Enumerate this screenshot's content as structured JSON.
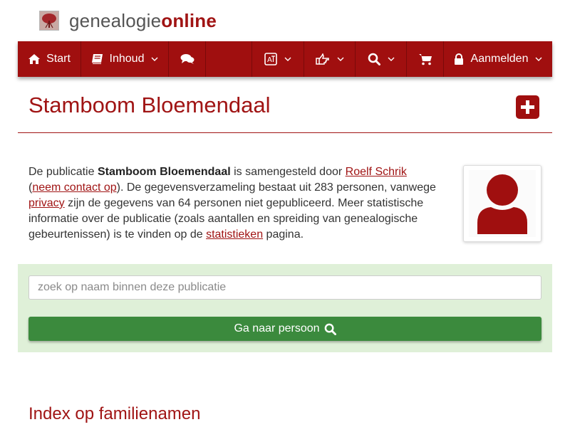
{
  "brand": {
    "part1": "genealogie",
    "part2": "online"
  },
  "nav": {
    "start": "Start",
    "inhoud": "Inhoud",
    "aanmelden": "Aanmelden"
  },
  "page": {
    "title": "Stamboom Bloemendaal"
  },
  "intro": {
    "t1": "De publicatie ",
    "pub_name": "Stamboom Bloemendaal",
    "t2": " is samengesteld door ",
    "author": "Roelf Schrik",
    "t3": "(",
    "contact": "neem contact op",
    "t4": "). De gegevensverzameling bestaat uit 283 personen, vanwege ",
    "privacy": "privacy",
    "t5": " zijn de gegevens van 64 personen niet gepubliceerd. Meer statistische informatie over de publicatie (zoals aantallen en spreiding van genealogische gebeurtenissen) is te vinden op de ",
    "stats": "statistieken",
    "t6": " pagina."
  },
  "search": {
    "placeholder": "zoek op naam binnen deze publicatie",
    "button": "Ga naar persoon"
  },
  "index": {
    "heading": "Index op familienamen"
  },
  "colors": {
    "brand_red": "#a00f0f",
    "panel_green": "#dff0d8",
    "button_green": "#3b8a3d"
  },
  "icons": [
    "tree-logo-icon",
    "home-icon",
    "book-icon",
    "comments-icon",
    "language-icon",
    "hand-point-icon",
    "search-icon",
    "cart-icon",
    "lock-icon",
    "chevron-down-icon",
    "plus-square-icon",
    "user-avatar-icon"
  ]
}
